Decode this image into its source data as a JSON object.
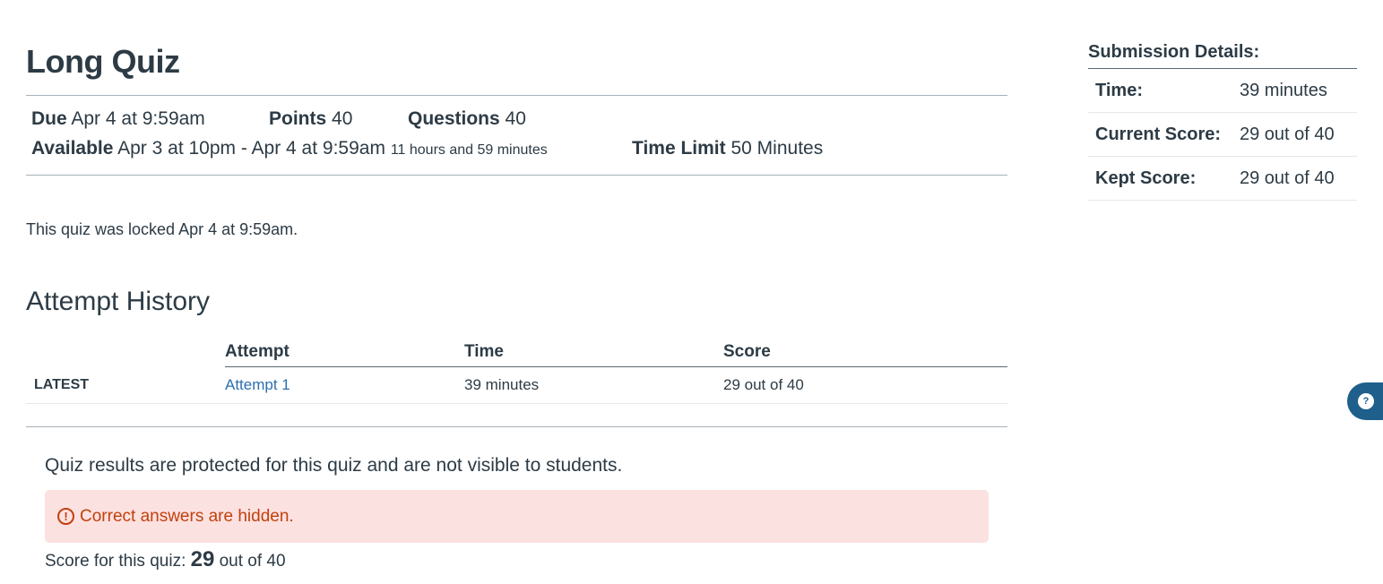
{
  "quiz": {
    "title": "Long Quiz",
    "due_label": "Due",
    "due_value": "Apr 4 at 9:59am",
    "points_label": "Points",
    "points_value": "40",
    "questions_label": "Questions",
    "questions_value": "40",
    "available_label": "Available",
    "available_value": "Apr 3 at 10pm - Apr 4 at 9:59am",
    "available_duration": "11 hours and 59 minutes",
    "time_limit_label": "Time Limit",
    "time_limit_value": "50 Minutes",
    "locked_message": "This quiz was locked Apr 4 at 9:59am."
  },
  "attempt_history": {
    "heading": "Attempt History",
    "columns": [
      "",
      "Attempt",
      "Time",
      "Score"
    ],
    "rows": [
      {
        "tag": "LATEST",
        "attempt": "Attempt 1",
        "time": "39 minutes",
        "score": "29 out of 40"
      }
    ]
  },
  "results": {
    "protected_message": "Quiz results are protected for this quiz and are not visible to students.",
    "alert_icon": "warning-circle-icon",
    "alert_text": "Correct answers are hidden.",
    "score_prefix": "Score for this quiz:",
    "score_value": "29",
    "score_suffix": "out of 40"
  },
  "submission_details": {
    "title": "Submission Details:",
    "rows": [
      {
        "label": "Time:",
        "value": "39 minutes"
      },
      {
        "label": "Current Score:",
        "value": "29 out of 40"
      },
      {
        "label": "Kept Score:",
        "value": "29 out of 40"
      }
    ]
  },
  "help_button": {
    "icon": "chat-help-icon"
  },
  "colors": {
    "text": "#2d3b45",
    "link": "#2b6fb0",
    "alert_bg": "#fce1e1",
    "alert_text": "#c2410c",
    "help_bg": "#1e5f8b"
  }
}
